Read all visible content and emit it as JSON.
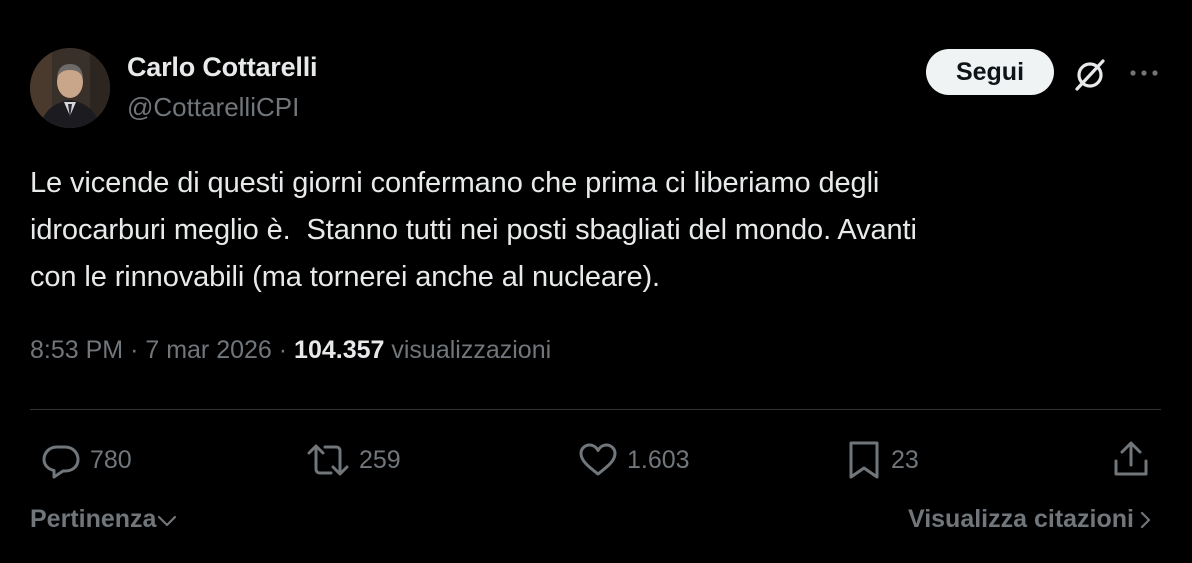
{
  "author": {
    "name": "Carlo Cottarelli",
    "handle": "@CottarelliCPI"
  },
  "header": {
    "follow_label": "Segui",
    "grok_icon": "grok-icon",
    "more_icon": "more-icon"
  },
  "tweet": {
    "text": "Le vicende di questi giorni confermano che prima ci liberiamo degli\nidrocarburi meglio è.  Stanno tutti nei posti sbagliati del mondo. Avanti\ncon le rinnovabili (ma tornerei anche al nucleare).",
    "time": "8:53 PM",
    "separator": "·",
    "date": "7 mar 2026",
    "views_count": "104.357",
    "views_label": "visualizzazioni"
  },
  "actions": {
    "reply_count": "780",
    "repost_count": "259",
    "like_count": "1.603",
    "bookmark_count": "23"
  },
  "footer": {
    "sort_label": "Pertinenza",
    "quotes_label": "Visualizza citazioni"
  },
  "colors": {
    "background": "#000000",
    "primary_text": "#e7e9ea",
    "secondary_text": "#71767b",
    "divider": "#2f3336",
    "button_bg": "#eff3f4"
  }
}
